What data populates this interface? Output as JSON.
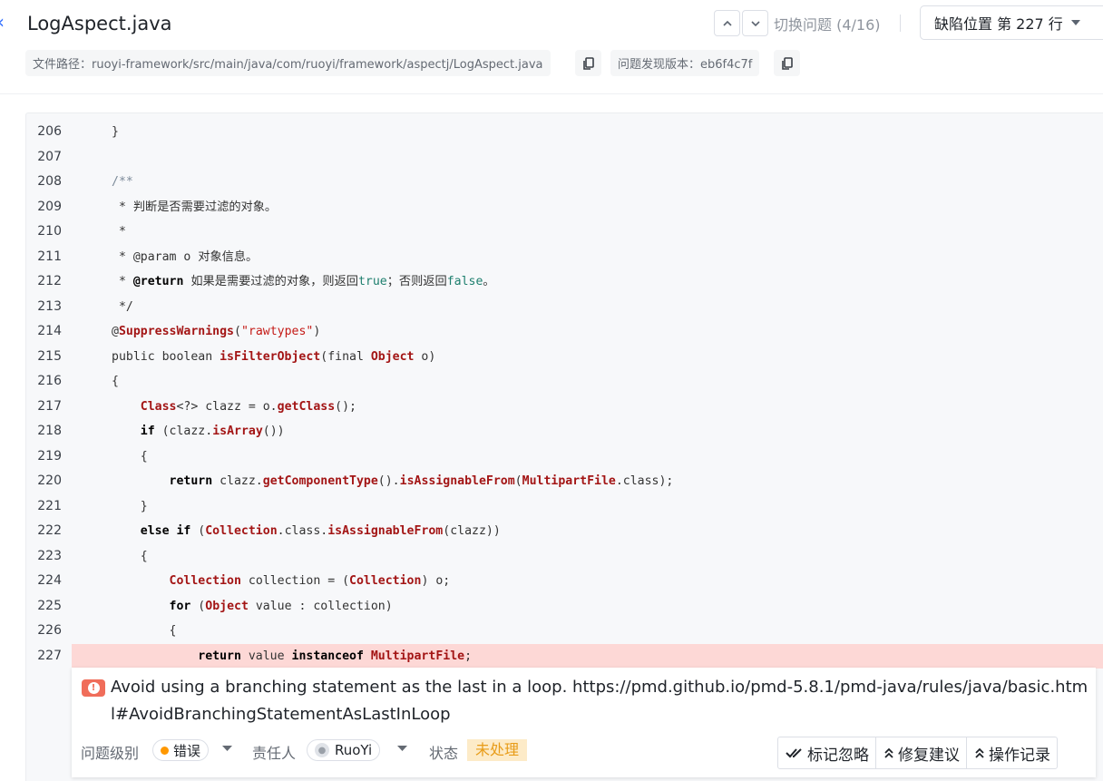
{
  "header": {
    "title": "LogAspect.java",
    "switch_issue_label": "切换问题 (4/16)",
    "location_label": "缺陷位置 第 227 行",
    "file_path": "文件路径：ruoyi-framework/src/main/java/com/ruoyi/framework/aspectj/LogAspect.java",
    "found_version": "问题发现版本：eb6f4c7f"
  },
  "code": {
    "highlight_line": 227,
    "lines": [
      {
        "n": "206",
        "html": "}"
      },
      {
        "n": "207",
        "html": ""
      },
      {
        "n": "208",
        "html": "<span class=\"cm-start\">/**</span>"
      },
      {
        "n": "209",
        "html": "<span class=\"cm\"> * 判断是否需要过滤的对象。</span>"
      },
      {
        "n": "210",
        "html": "<span class=\"cm\"> *</span>"
      },
      {
        "n": "211",
        "html": "<span class=\"cm\"> * @param o 对象信息。</span>"
      },
      {
        "n": "212",
        "html": "<span class=\"cm\"> * <span class=\"kw\">@return</span> 如果是需要过滤的对象，则返回<span class=\"lit\">true</span>；否则返回<span class=\"lit\">false</span>。</span>"
      },
      {
        "n": "213",
        "html": "<span class=\"cm\"> */</span>"
      },
      {
        "n": "214",
        "html": "@<span class=\"cl\">SuppressWarnings</span>(<span class=\"str\">\"rawtypes\"</span>)"
      },
      {
        "n": "215",
        "html": "public boolean <span class=\"fn\">isFilterObject</span>(final <span class=\"cl\">Object</span> o)"
      },
      {
        "n": "216",
        "html": "{"
      },
      {
        "n": "217",
        "html": "    <span class=\"cl\">Class</span>&lt;?&gt; clazz = o.<span class=\"fn\">getClass</span>();"
      },
      {
        "n": "218",
        "html": "    <span class=\"kw\">if</span> (clazz.<span class=\"fn\">isArray</span>())"
      },
      {
        "n": "219",
        "html": "    {"
      },
      {
        "n": "220",
        "html": "        <span class=\"kw\">return</span> clazz.<span class=\"fn\">getComponentType</span>().<span class=\"fn\">isAssignableFrom</span>(<span class=\"cl\">MultipartFile</span>.class);"
      },
      {
        "n": "221",
        "html": "    }"
      },
      {
        "n": "222",
        "html": "    <span class=\"kw\">else if</span> (<span class=\"cl\">Collection</span>.class.<span class=\"fn\">isAssignableFrom</span>(clazz))"
      },
      {
        "n": "223",
        "html": "    {"
      },
      {
        "n": "224",
        "html": "        <span class=\"cl\">Collection</span> collection = (<span class=\"cl\">Collection</span>) o;"
      },
      {
        "n": "225",
        "html": "        <span class=\"kw\">for</span> (<span class=\"cl\">Object</span> value : collection)"
      },
      {
        "n": "226",
        "html": "        {"
      },
      {
        "n": "227",
        "html": "            <span class=\"kw\">return</span> value <span class=\"kw\">instanceof</span> <span class=\"cl\">MultipartFile</span>;"
      }
    ]
  },
  "issue": {
    "message": "Avoid using a branching statement as the last in a loop. https://pmd.github.io/pmd-5.8.1/pmd-java/rules/java/basic.html#AvoidBranchingStatementAsLastInLoop",
    "severity_label": "问题级别",
    "severity_value": "错误",
    "assignee_label": "责任人",
    "assignee_value": "RuoYi",
    "status_label": "状态",
    "status_value": "未处理",
    "actions": {
      "ignore": "标记忽略",
      "fix": "修复建议",
      "history": "操作记录"
    }
  },
  "colors": {
    "highlight_bg": "#fdd8d6",
    "error_icon": "#f06d5a",
    "severity_dot": "#ff9800",
    "status_bg": "#fdebc8",
    "status_fg": "#e89c19"
  }
}
